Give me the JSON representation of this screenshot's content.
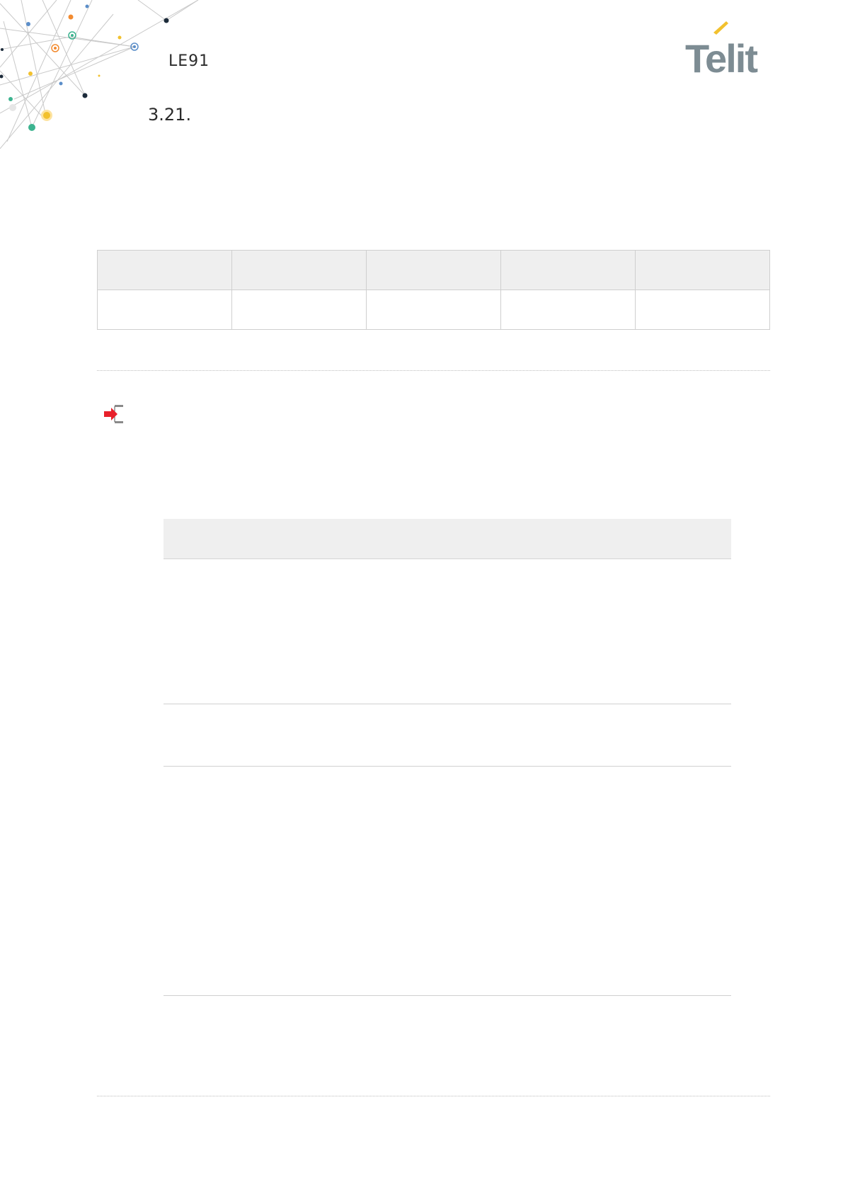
{
  "header": {
    "doc_title": "LE91",
    "section_number": "3.21.",
    "logo_text": "Telit"
  },
  "colors": {
    "brand_gray": "#7d8c93",
    "logo_accent": "#f2c12e",
    "arrow_red": "#e8202a",
    "table_header_bg": "#efefef"
  },
  "icons": {
    "arrow": "red-right-arrow-icon"
  }
}
